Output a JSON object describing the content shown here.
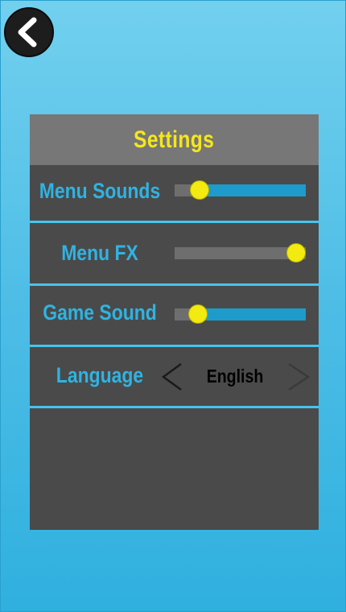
{
  "header": {
    "back_icon": "chevron-left-icon",
    "title": "Settings"
  },
  "settings": {
    "menu_sounds": {
      "label": "Menu Sounds",
      "level": 0.14
    },
    "menu_fx": {
      "label": "Menu FX",
      "level": 1.0
    },
    "game_sound": {
      "label": "Game Sound",
      "level": 0.12
    },
    "language": {
      "label": "Language",
      "value": "English",
      "prev_icon": "chevron-left-icon",
      "next_icon": "chevron-right-icon"
    }
  },
  "colors": {
    "background": "#4dbde6",
    "panel": "#4a4a4a",
    "header": "#777777",
    "title": "#f5e61c",
    "label": "#2fb3e2",
    "slider_fill": "#1d9ccc",
    "slider_track": "#6e6e6e",
    "knob": "#f2ea10",
    "divider": "#45c4ee"
  }
}
